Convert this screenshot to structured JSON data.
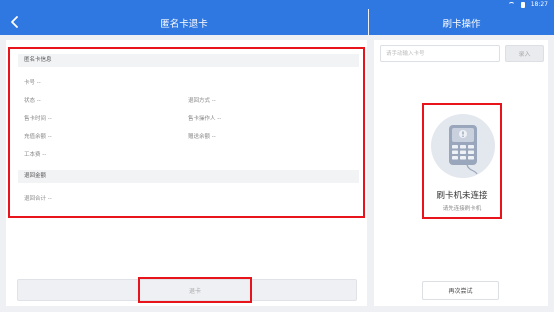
{
  "status_bar": {
    "time": "18:27"
  },
  "header": {
    "title": "匿名卡退卡",
    "right_title": "刷卡操作"
  },
  "card_info": {
    "section_title": "匿名卡信息",
    "card_no": "卡号 --",
    "status": "状态 --",
    "refund_method": "退回方式 --",
    "sell_time": "售卡时间 --",
    "sell_operator": "售卡操作人 --",
    "recharge_balance": "充值余额 --",
    "gift_balance": "赠送余额 --",
    "deposit": "工本费 --"
  },
  "refund_amount": {
    "section_title": "退回金额",
    "total": "退回合计 --"
  },
  "actions": {
    "refund_label": "退卡"
  },
  "swipe": {
    "input_placeholder": "请手动输入卡号",
    "enter_label": "录入",
    "reader_status": "刷卡机未连接",
    "reader_hint": "请先连接刷卡机",
    "retry_label": "再次尝试"
  },
  "colors": {
    "header_bg": "#2f78e2",
    "highlight": "#e8141c",
    "page_bg": "#eef0f3"
  },
  "icons": {
    "back": "chevron-left-icon",
    "reader": "card-reader-icon",
    "wifi": "wifi-icon",
    "battery": "battery-icon"
  }
}
